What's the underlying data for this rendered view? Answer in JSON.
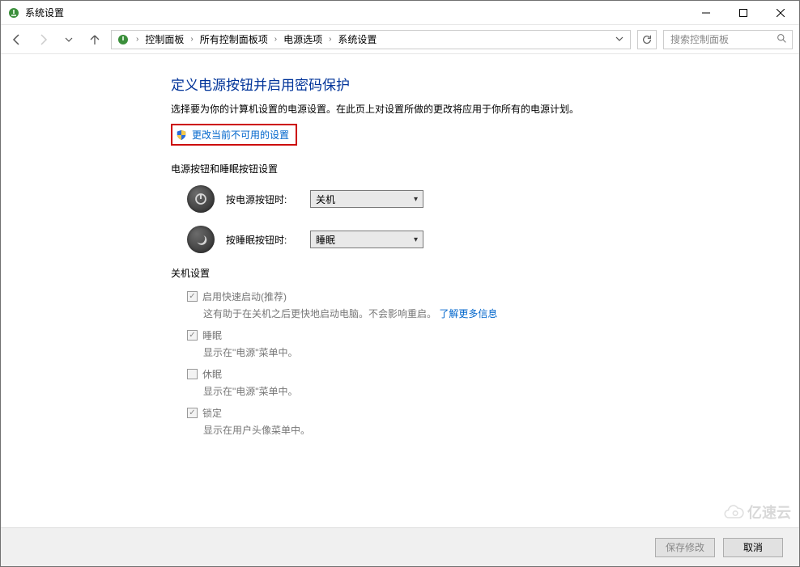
{
  "window": {
    "title": "系统设置"
  },
  "nav": {
    "breadcrumb": [
      "控制面板",
      "所有控制面板项",
      "电源选项",
      "系统设置"
    ],
    "search_placeholder": "搜索控制面板"
  },
  "page": {
    "title": "定义电源按钮并启用密码保护",
    "desc": "选择要为你的计算机设置的电源设置。在此页上对设置所做的更改将应用于你所有的电源计划。",
    "admin_link": "更改当前不可用的设置"
  },
  "power_section": {
    "heading": "电源按钮和睡眠按钮设置",
    "rows": [
      {
        "label": "按电源按钮时:",
        "value": "关机",
        "icon": "power"
      },
      {
        "label": "按睡眠按钮时:",
        "value": "睡眠",
        "icon": "sleep"
      }
    ]
  },
  "shutdown_section": {
    "heading": "关机设置",
    "items": [
      {
        "checked": true,
        "label": "启用快速启动(推荐)",
        "sub_pre": "这有助于在关机之后更快地启动电脑。不会影响重启。",
        "sub_link": "了解更多信息"
      },
      {
        "checked": true,
        "label": "睡眠",
        "sub_pre": "显示在\"电源\"菜单中。",
        "sub_link": ""
      },
      {
        "checked": false,
        "label": "休眠",
        "sub_pre": "显示在\"电源\"菜单中。",
        "sub_link": ""
      },
      {
        "checked": true,
        "label": "锁定",
        "sub_pre": "显示在用户头像菜单中。",
        "sub_link": ""
      }
    ]
  },
  "footer": {
    "save": "保存修改",
    "cancel": "取消"
  },
  "watermark": "亿速云"
}
